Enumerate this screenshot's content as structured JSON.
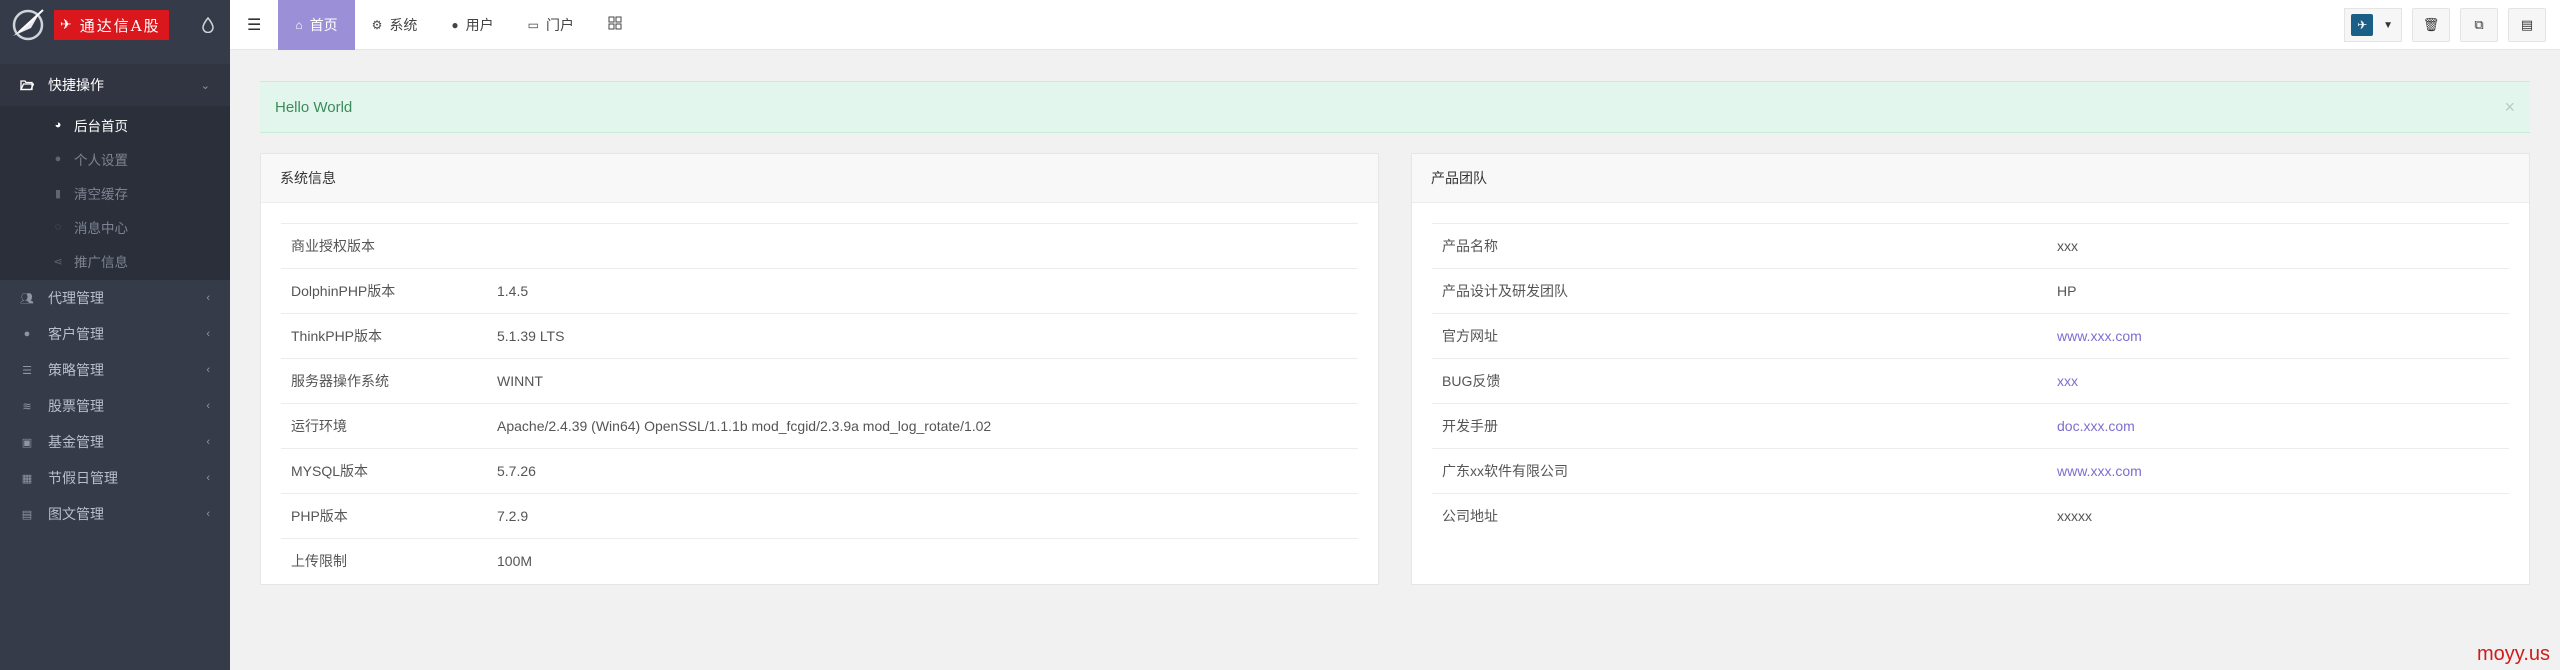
{
  "logo": {
    "brand_text": "通达信A股"
  },
  "sidebar": {
    "groups": [
      {
        "label": "快捷操作",
        "icon": "folder-open-icon",
        "open": true,
        "items": [
          {
            "label": "后台首页",
            "icon": "dashboard-icon",
            "active": true
          },
          {
            "label": "个人设置",
            "icon": "user-icon"
          },
          {
            "label": "清空缓存",
            "icon": "trash-icon"
          },
          {
            "label": "消息中心",
            "icon": "comments-icon"
          },
          {
            "label": "推广信息",
            "icon": "share-icon"
          }
        ]
      },
      {
        "label": "代理管理",
        "icon": "users-icon"
      },
      {
        "label": "客户管理",
        "icon": "user-icon"
      },
      {
        "label": "策略管理",
        "icon": "list-icon"
      },
      {
        "label": "股票管理",
        "icon": "database-icon"
      },
      {
        "label": "基金管理",
        "icon": "money-icon"
      },
      {
        "label": "节假日管理",
        "icon": "calendar-icon"
      },
      {
        "label": "图文管理",
        "icon": "image-icon"
      }
    ]
  },
  "topbar": {
    "tabs": [
      {
        "label": "首页",
        "icon": "home-icon",
        "active": true
      },
      {
        "label": "系统",
        "icon": "gear-icon"
      },
      {
        "label": "用户",
        "icon": "user-icon"
      },
      {
        "label": "门户",
        "icon": "newspaper-icon"
      },
      {
        "label": "",
        "icon": "grid-icon"
      }
    ],
    "right_buttons": [
      "trash-icon",
      "external-link-icon",
      "sidebar-toggle-icon"
    ]
  },
  "alert": {
    "text": "Hello World"
  },
  "system_panel": {
    "title": "系统信息",
    "rows": [
      {
        "key": "商业授权版本",
        "value": ""
      },
      {
        "key": "DolphinPHP版本",
        "value": "1.4.5"
      },
      {
        "key": "ThinkPHP版本",
        "value": "5.1.39 LTS"
      },
      {
        "key": "服务器操作系统",
        "value": "WINNT"
      },
      {
        "key": "运行环境",
        "value": "Apache/2.4.39 (Win64) OpenSSL/1.1.1b mod_fcgid/2.3.9a mod_log_rotate/1.02"
      },
      {
        "key": "MYSQL版本",
        "value": "5.7.26"
      },
      {
        "key": "PHP版本",
        "value": "7.2.9"
      },
      {
        "key": "上传限制",
        "value": "100M"
      }
    ]
  },
  "team_panel": {
    "title": "产品团队",
    "rows": [
      {
        "key": "产品名称",
        "value": "xxx",
        "link": false
      },
      {
        "key": "产品设计及研发团队",
        "value": "HP",
        "link": false
      },
      {
        "key": "官方网址",
        "value": "www.xxx.com",
        "link": true
      },
      {
        "key": "BUG反馈",
        "value": "xxx",
        "link": true
      },
      {
        "key": "开发手册",
        "value": "doc.xxx.com",
        "link": true
      },
      {
        "key": "广东xx软件有限公司",
        "value": "www.xxx.com",
        "link": true
      },
      {
        "key": "公司地址",
        "value": "xxxxx",
        "link": false
      }
    ]
  },
  "watermark": "moyy.us",
  "colors": {
    "sidebar_bg": "#353b48",
    "active_tab": "#9b8fd8",
    "alert_bg": "#e3f6ee",
    "link": "#7b6fd0",
    "logo_red": "#d9171d"
  }
}
